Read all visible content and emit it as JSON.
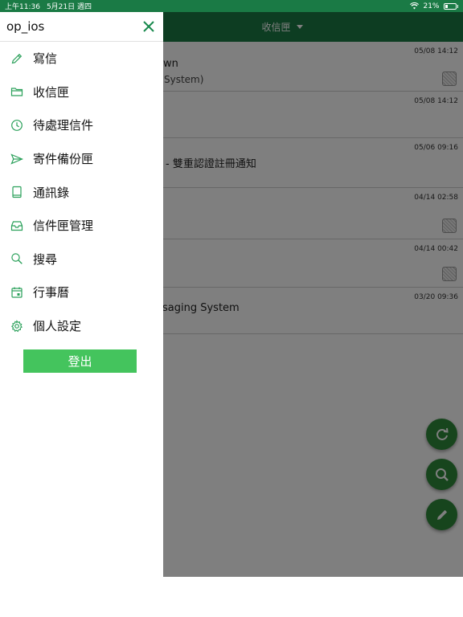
{
  "status_bar": {
    "time": "上午11:36",
    "date": "5月21日 週四",
    "battery": "21%"
  },
  "app": {
    "folder_title": "收信匣"
  },
  "drawer": {
    "username": "op_ios",
    "menu": [
      {
        "label": "寫信",
        "icon": "pencil-icon"
      },
      {
        "label": "收信匣",
        "icon": "folder-icon"
      },
      {
        "label": "待處理信件",
        "icon": "clock-icon"
      },
      {
        "label": "寄件備份匣",
        "icon": "send-icon"
      },
      {
        "label": "通訊錄",
        "icon": "book-icon"
      },
      {
        "label": "信件匣管理",
        "icon": "inbox-tray-icon"
      },
      {
        "label": "搜尋",
        "icon": "search-icon"
      },
      {
        "label": "行事曆",
        "icon": "calendar-icon"
      },
      {
        "label": "個人設定",
        "icon": "gear-icon"
      }
    ],
    "logout_label": "登出"
  },
  "mails": [
    {
      "date": "05/08 14:12",
      "line1": "wn",
      "line2": "System)"
    },
    {
      "date": "05/08 14:12"
    },
    {
      "date": "05/06 09:16",
      "line1": "- 雙重認證註冊通知"
    },
    {
      "date": "04/14 02:58"
    },
    {
      "date": "04/14 00:42"
    },
    {
      "date": "03/20 09:36",
      "line1": "saging System"
    }
  ],
  "colors": {
    "accent": "#1a7a45",
    "logout": "#44c45d",
    "fab": "#2f8a3b",
    "icon": "#2aa05a"
  }
}
